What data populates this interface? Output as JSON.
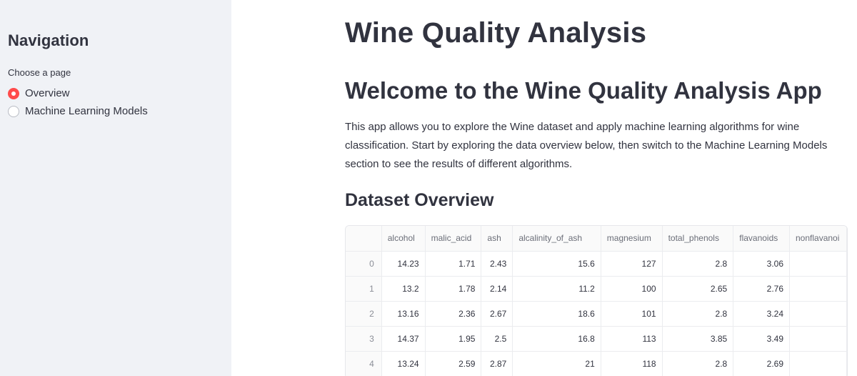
{
  "sidebar": {
    "title": "Navigation",
    "radio_label": "Choose a page",
    "options": [
      {
        "label": "Overview",
        "selected": true
      },
      {
        "label": "Machine Learning Models",
        "selected": false
      }
    ]
  },
  "main": {
    "title": "Wine Quality Analysis",
    "welcome": "Welcome to the Wine Quality Analysis App",
    "description": "This app allows you to explore the Wine dataset and apply machine learning algorithms for wine classification. Start by exploring the data overview below, then switch to the Machine Learning Models section to see the results of different algorithms.",
    "overview_heading": "Dataset Overview"
  },
  "table": {
    "columns": [
      "alcohol",
      "malic_acid",
      "ash",
      "alcalinity_of_ash",
      "magnesium",
      "total_phenols",
      "flavanoids",
      "nonflavanoi"
    ],
    "rows": [
      {
        "index": "0",
        "cells": [
          "14.23",
          "1.71",
          "2.43",
          "15.6",
          "127",
          "2.8",
          "3.06",
          ""
        ]
      },
      {
        "index": "1",
        "cells": [
          "13.2",
          "1.78",
          "2.14",
          "11.2",
          "100",
          "2.65",
          "2.76",
          ""
        ]
      },
      {
        "index": "2",
        "cells": [
          "13.16",
          "2.36",
          "2.67",
          "18.6",
          "101",
          "2.8",
          "3.24",
          ""
        ]
      },
      {
        "index": "3",
        "cells": [
          "14.37",
          "1.95",
          "2.5",
          "16.8",
          "113",
          "3.85",
          "3.49",
          ""
        ]
      },
      {
        "index": "4",
        "cells": [
          "13.24",
          "2.59",
          "2.87",
          "21",
          "118",
          "2.8",
          "2.69",
          ""
        ]
      }
    ]
  },
  "colors": {
    "accent": "#ff4b4b",
    "sidebar_bg": "#f0f2f6",
    "text": "#31333f"
  }
}
